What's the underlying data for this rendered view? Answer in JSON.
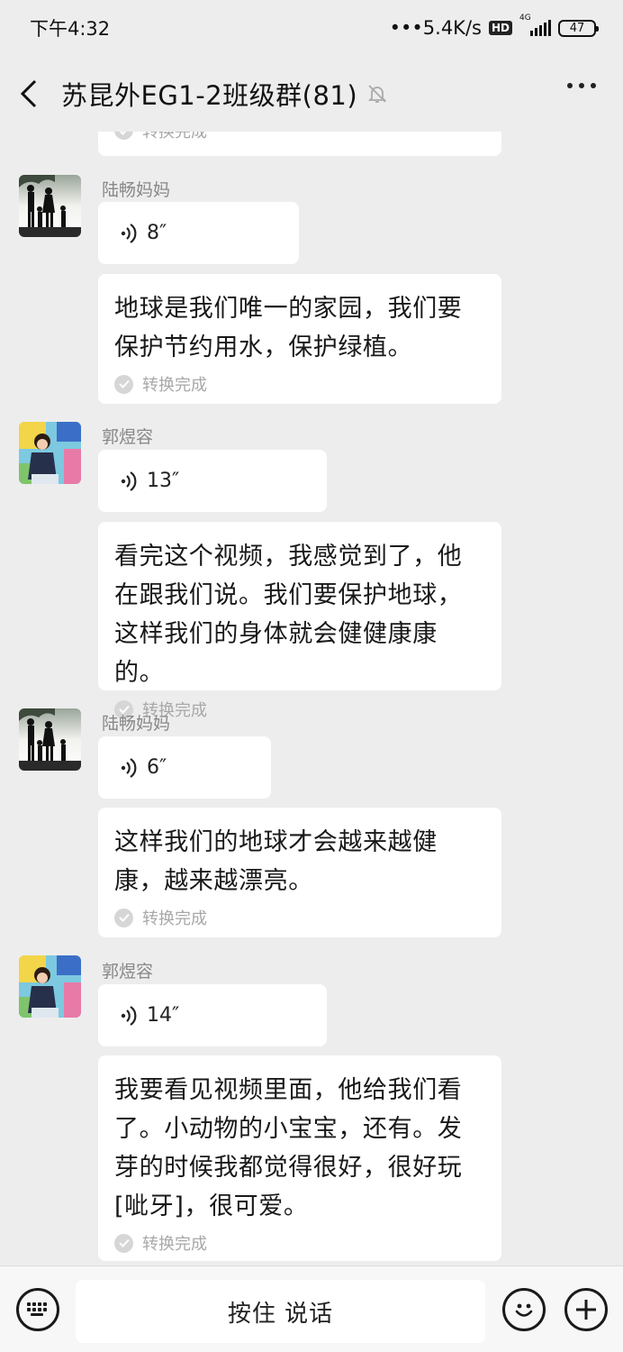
{
  "status_bar": {
    "time": "下午4:32",
    "network_speed": "•••5.4K/s",
    "hd_badge": "HD",
    "network_type": "4G",
    "battery": "47"
  },
  "header": {
    "title": "苏昆外EG1-2班级群(81)"
  },
  "conversion_label": "转换完成",
  "messages": [
    {
      "sender": "陆畅妈妈",
      "duration": "8″",
      "text": "地球是我们唯一的家园，我们要保护节约用水，保护绿植。"
    },
    {
      "sender": "郭煜容",
      "duration": "13″",
      "text": "看完这个视频，我感觉到了，他在跟我们说。我们要保护地球，这样我们的身体就会健健康康的。"
    },
    {
      "sender": "陆畅妈妈",
      "duration": "6″",
      "text": "这样我们的地球才会越来越健康，越来越漂亮。"
    },
    {
      "sender": "郭煜容",
      "duration": "14″",
      "text": "我要看见视频里面，他给我们看了。小动物的小宝宝，还有。发芽的时候我都觉得很好，很好玩[呲牙]，很可爱。"
    }
  ],
  "input_bar": {
    "hold_to_talk": "按住 说话",
    "icons": [
      "keyboard-icon",
      "emoji-icon",
      "plus-icon"
    ]
  },
  "colors": {
    "background": "#ededed",
    "bubble": "#ffffff",
    "muted_text": "#888888"
  }
}
